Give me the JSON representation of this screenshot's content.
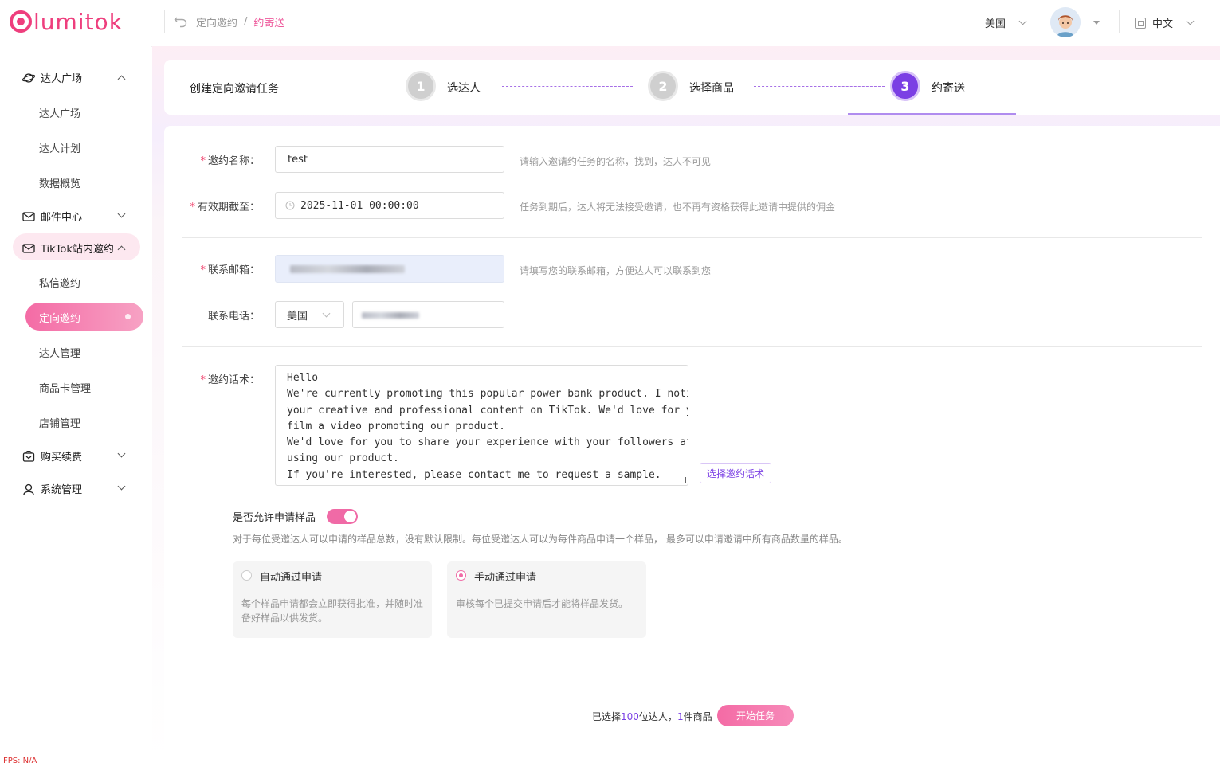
{
  "brand": {
    "name": "lumitok"
  },
  "breadcrumb": {
    "items": [
      "定向邀约",
      "约寄送"
    ],
    "separator": "/"
  },
  "header": {
    "region": "美国",
    "language": "中文"
  },
  "sidebar": {
    "groups": [
      {
        "label": "达人广场",
        "items": [
          "达人广场",
          "达人计划",
          "数据概览"
        ]
      },
      {
        "label": "邮件中心",
        "items": []
      },
      {
        "label": "TikTok站内邀约",
        "items": [
          "私信邀约",
          "定向邀约",
          "达人管理",
          "商品卡管理",
          "店铺管理"
        ]
      },
      {
        "label": "购买续费",
        "items": []
      },
      {
        "label": "系统管理",
        "items": []
      }
    ],
    "active_item": "定向邀约",
    "fps": "FPS: N/A"
  },
  "steps": {
    "title": "创建定向邀请任务",
    "items": [
      {
        "num": "1",
        "label": "选达人"
      },
      {
        "num": "2",
        "label": "选择商品"
      },
      {
        "num": "3",
        "label": "约寄送"
      }
    ],
    "active": 3
  },
  "form": {
    "name": {
      "label": "邀约名称：",
      "value": "test",
      "hint": "请输入邀请约任务的名称，找到，达人不可见"
    },
    "expiry": {
      "label": "有效期截至：",
      "value": "2025-11-01 00:00:00",
      "hint": "任务到期后，达人将无法接受邀请，也不再有资格获得此邀请中提供的佣金"
    },
    "email": {
      "label": "联系邮箱：",
      "hint": "请填写您的联系邮箱，方便达人可以联系到您"
    },
    "phone": {
      "label": "联系电话：",
      "country": "美国"
    },
    "script": {
      "label": "邀约话术：",
      "lines": [
        "Hello",
        "We're currently promoting this popular power bank product. I noticed",
        "your creative and professional content on TikTok. We'd love for you to",
        "film a video promoting our product.",
        "We'd love for you to share your experience with your followers after",
        "using our product.",
        "If you're interested, please contact me to request a sample."
      ],
      "pick_button": "选择邀约话术"
    },
    "sample": {
      "toggle_label": "是否允许申请样品",
      "enabled": true,
      "description": "对于每位受邀达人可以申请的样品总数，没有默认限制。每位受邀达人可以为每件商品申请一个样品， 最多可以申请邀请中所有商品数量的样品。",
      "options": [
        {
          "title": "自动通过申请",
          "desc": "每个样品申请都会立即获得批准，并随时准备好样品以供发货。",
          "selected": false
        },
        {
          "title": "手动通过申请",
          "desc": "审核每个已提交申请后才能将样品发货。",
          "selected": true
        }
      ]
    }
  },
  "footer": {
    "prefix": "已选择",
    "creators": "100",
    "mid": "位达人，",
    "products": "1",
    "suffix": "件商品",
    "start_button": "开始任务"
  },
  "colors": {
    "brand": "#ee3e7d",
    "accent": "#7b3fe4",
    "pink": "#f06aa6"
  }
}
